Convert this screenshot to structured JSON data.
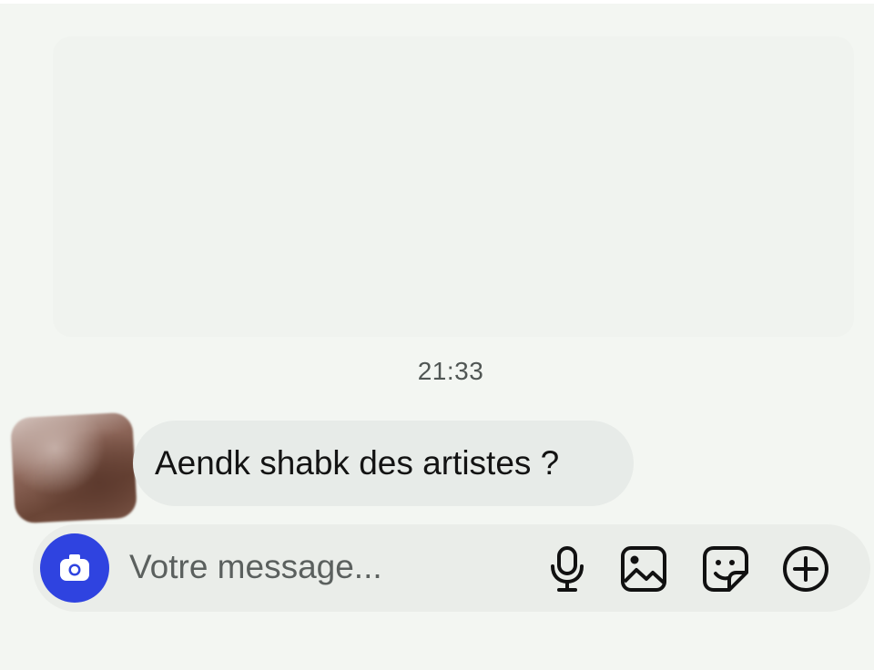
{
  "conversation": {
    "timestamp": "21:33",
    "messages": [
      {
        "sender": "other",
        "text": "Aendk shabk des artistes ?"
      }
    ]
  },
  "composer": {
    "placeholder": "Votre message...",
    "value": "",
    "buttons": {
      "camera": "camera-icon",
      "voice": "microphone-icon",
      "gallery": "image-icon",
      "sticker": "sticker-icon",
      "more": "plus-circle-icon"
    }
  },
  "colors": {
    "background": "#f3f6f2",
    "bubble": "#e7ebe8",
    "composer": "#eaede9",
    "camera_button": "#2f43e0",
    "text": "#131313",
    "muted_text": "#505654"
  }
}
